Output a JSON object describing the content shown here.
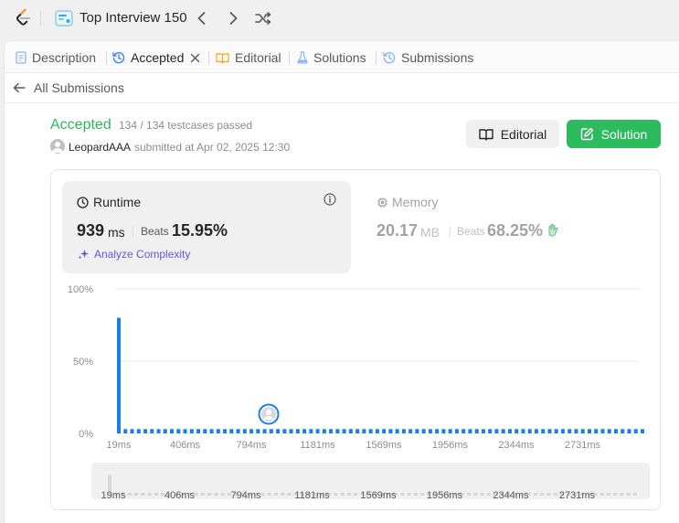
{
  "topbar": {
    "study_title": "Top Interview 150"
  },
  "tabs": [
    {
      "label": "Description",
      "icon": "description-icon"
    },
    {
      "label": "Accepted",
      "icon": "history-icon"
    },
    {
      "label": "Editorial",
      "icon": "book-icon"
    },
    {
      "label": "Solutions",
      "icon": "flask-icon"
    },
    {
      "label": "Submissions",
      "icon": "history-icon"
    }
  ],
  "back": {
    "label": "All Submissions"
  },
  "result": {
    "status": "Accepted",
    "testcases": "134 / 134 testcases passed",
    "username": "LeopardAAA",
    "submitted": "submitted at Apr 02, 2025 12:30"
  },
  "buttons": {
    "editorial": "Editorial",
    "solution": "Solution"
  },
  "runtime": {
    "title": "Runtime",
    "value": "939",
    "unit": "ms",
    "beats_label": "Beats",
    "beats": "15.95%",
    "analyze": "Analyze Complexity"
  },
  "memory": {
    "title": "Memory",
    "value": "20.17",
    "unit": "MB",
    "beats_label": "Beats",
    "beats": "68.25%"
  },
  "colors": {
    "accepted": "#2db55d",
    "solution_button": "#2cbb5d",
    "bar": "#1a7ee8",
    "analyze": "#6b54d6"
  },
  "chart_data": {
    "type": "bar",
    "ylim": [
      0,
      100
    ],
    "y_ticks": [
      "100%",
      "50%",
      "0%"
    ],
    "x_ticks": [
      "19ms",
      "406ms",
      "794ms",
      "1181ms",
      "1569ms",
      "1956ms",
      "2344ms",
      "2731ms"
    ],
    "values": [
      80,
      3,
      3,
      3,
      3,
      3,
      3,
      3,
      3,
      3,
      3,
      3,
      3,
      3,
      3,
      3,
      3,
      3,
      3,
      3,
      3,
      3,
      3,
      3,
      3,
      3,
      3,
      3,
      3,
      3,
      3,
      3,
      3,
      3,
      3,
      3,
      3,
      3,
      3,
      3,
      3,
      3,
      3,
      3,
      3,
      3,
      3,
      3,
      3,
      3,
      3,
      3,
      3,
      3,
      3,
      3,
      3,
      3,
      3,
      3,
      3,
      3,
      3,
      3,
      3,
      3,
      3,
      3,
      3,
      3,
      3,
      3,
      3,
      3,
      3,
      3,
      3,
      3,
      3,
      3
    ],
    "marker_label": "939ms",
    "grid": true
  }
}
